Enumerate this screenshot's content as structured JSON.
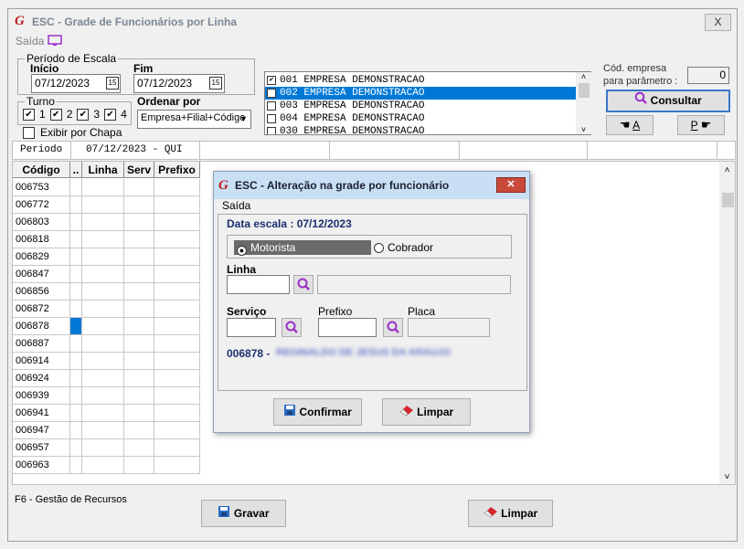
{
  "window": {
    "title": "ESC - Grade de Funcionários por Linha",
    "close": "X"
  },
  "menu": {
    "saida": "Saída"
  },
  "periodo": {
    "legend": "Período de Escala",
    "inicio_label": "Início",
    "inicio_value": "07/12/2023",
    "fim_label": "Fim",
    "fim_value": "07/12/2023",
    "cal_glyph": "15"
  },
  "turno": {
    "legend": "Turno",
    "options": [
      {
        "label": "1",
        "checked": true
      },
      {
        "label": "2",
        "checked": true
      },
      {
        "label": "3",
        "checked": true
      },
      {
        "label": "4",
        "checked": true
      }
    ],
    "exibir_chapa": "Exibir por Chapa"
  },
  "ordenar": {
    "label": "Ordenar por",
    "value": "Empresa+Filial+Código"
  },
  "empresas": [
    {
      "text": "001 EMPRESA DEMONSTRACAO",
      "checked": true,
      "selected": false
    },
    {
      "text": "002 EMPRESA DEMONSTRACAO",
      "checked": true,
      "selected": true
    },
    {
      "text": "003 EMPRESA DEMONSTRACAO",
      "checked": false,
      "selected": false
    },
    {
      "text": "004 EMPRESA DEMONSTRACAO",
      "checked": false,
      "selected": false
    },
    {
      "text": "030 EMPRESA DEMONSTRACAO",
      "checked": false,
      "selected": false
    }
  ],
  "cod_empresa": {
    "label1": "Cód. empresa",
    "label2": "para parâmetro :",
    "value": "0"
  },
  "buttons": {
    "consultar": "Consultar",
    "a": "A",
    "p": "P",
    "gravar": "Gravar",
    "limpar": "Limpar"
  },
  "periodo_bar": {
    "label": "Periodo",
    "value": "07/12/2023 - QUI"
  },
  "grid": {
    "headers": [
      "Código",
      "..",
      "Linha",
      "Serv",
      "Prefixo"
    ],
    "rows": [
      "006753",
      "006772",
      "006803",
      "006818",
      "006829",
      "006847",
      "006856",
      "006872",
      "006878",
      "006887",
      "006914",
      "006924",
      "006939",
      "006941",
      "006947",
      "006957",
      "006963"
    ],
    "selected_index": 8
  },
  "status": {
    "text": "F6 - Gestão de Recursos"
  },
  "dialog": {
    "title": "ESC - Alteração na grade por funcionário",
    "menu_saida": "Saída",
    "data_escala": "Data escala : 07/12/2023",
    "motorista": "Motorista",
    "cobrador": "Cobrador",
    "linha_label": "Linha",
    "servico_label": "Serviço",
    "prefixo_label": "Prefixo",
    "placa_label": "Placa",
    "func_code": "006878 -",
    "func_name": "REGINALDO DE JESUS DA ARAUJO",
    "confirmar": "Confirmar",
    "limpar": "Limpar"
  }
}
